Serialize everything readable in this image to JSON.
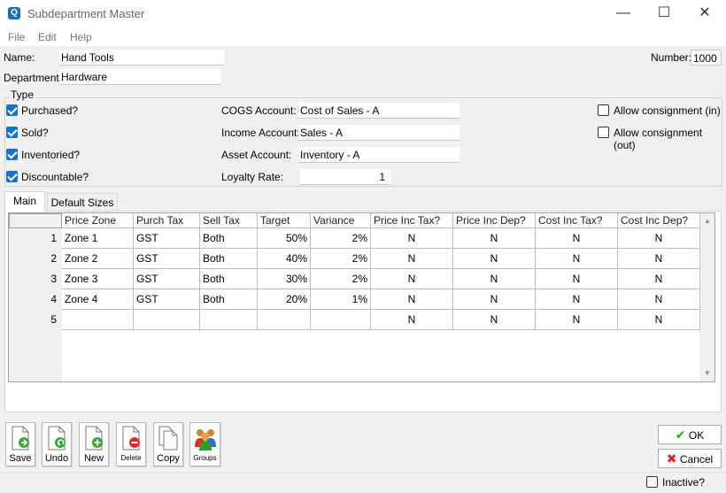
{
  "window": {
    "title": "Subdepartment Master",
    "minimize": "—",
    "maximize": "☐",
    "close": "✕",
    "app_icon_letter": "Q"
  },
  "menu": [
    "File",
    "Edit",
    "Help"
  ],
  "form": {
    "name_label": "Name:",
    "name_value": "Hand Tools",
    "department_label": "Department:",
    "department_value": "Hardware",
    "number_label": "Number:",
    "number_value": "1000"
  },
  "type_group": {
    "legend": "Type",
    "checks": [
      {
        "label": "Purchased?",
        "checked": true
      },
      {
        "label": "Sold?",
        "checked": true
      },
      {
        "label": "Inventoried?",
        "checked": true
      },
      {
        "label": "Discountable?",
        "checked": true
      }
    ],
    "cogs_label": "COGS Account:",
    "cogs_value": "Cost of Sales - A",
    "income_label": "Income Account:",
    "income_value": "Sales - A",
    "asset_label": "Asset Account:",
    "asset_value": "Inventory - A",
    "loyalty_label": "Loyalty Rate:",
    "loyalty_value": "1",
    "consign_in": {
      "label": "Allow consignment (in)",
      "checked": false
    },
    "consign_out": {
      "label": "Allow consignment (out)",
      "checked": false
    }
  },
  "tabs": [
    {
      "label": "Main",
      "active": true
    },
    {
      "label": "Default Sizes",
      "active": false
    }
  ],
  "grid": {
    "columns": [
      "Price Zone",
      "Purch Tax",
      "Sell Tax",
      "Target",
      "Variance",
      "Price Inc Tax?",
      "Price Inc Dep?",
      "Cost Inc Tax?",
      "Cost Inc Dep?"
    ],
    "rows": [
      {
        "num": "1",
        "cells": [
          "Zone 1",
          "GST",
          "Both",
          "50%",
          "2%",
          "N",
          "N",
          "N",
          "N"
        ]
      },
      {
        "num": "2",
        "cells": [
          "Zone 2",
          "GST",
          "Both",
          "40%",
          "2%",
          "N",
          "N",
          "N",
          "N"
        ]
      },
      {
        "num": "3",
        "cells": [
          "Zone 3",
          "GST",
          "Both",
          "30%",
          "2%",
          "N",
          "N",
          "N",
          "N"
        ]
      },
      {
        "num": "4",
        "cells": [
          "Zone 4",
          "GST",
          "Both",
          "20%",
          "1%",
          "N",
          "N",
          "N",
          "N"
        ]
      },
      {
        "num": "5",
        "cells": [
          "",
          "",
          "",
          "",
          "",
          "N",
          "N",
          "N",
          "N"
        ]
      }
    ],
    "scroll_up": "▲",
    "scroll_down": "▼"
  },
  "toolbar": {
    "save": "Save",
    "undo": "Undo",
    "new": "New",
    "delete": "Delete",
    "copy": "Copy",
    "groups": "Groups"
  },
  "dialog": {
    "ok": "OK",
    "cancel": "Cancel",
    "ok_glyph": "✔",
    "cancel_glyph": "✖"
  },
  "inactive": {
    "label": "Inactive?",
    "checked": false
  },
  "colors": {
    "accent_blue": "#1873c6",
    "ok_green": "#2e9e2e",
    "cancel_red": "#d42a2a",
    "new_green": "#3aa637",
    "delete_red": "#d6302b"
  }
}
